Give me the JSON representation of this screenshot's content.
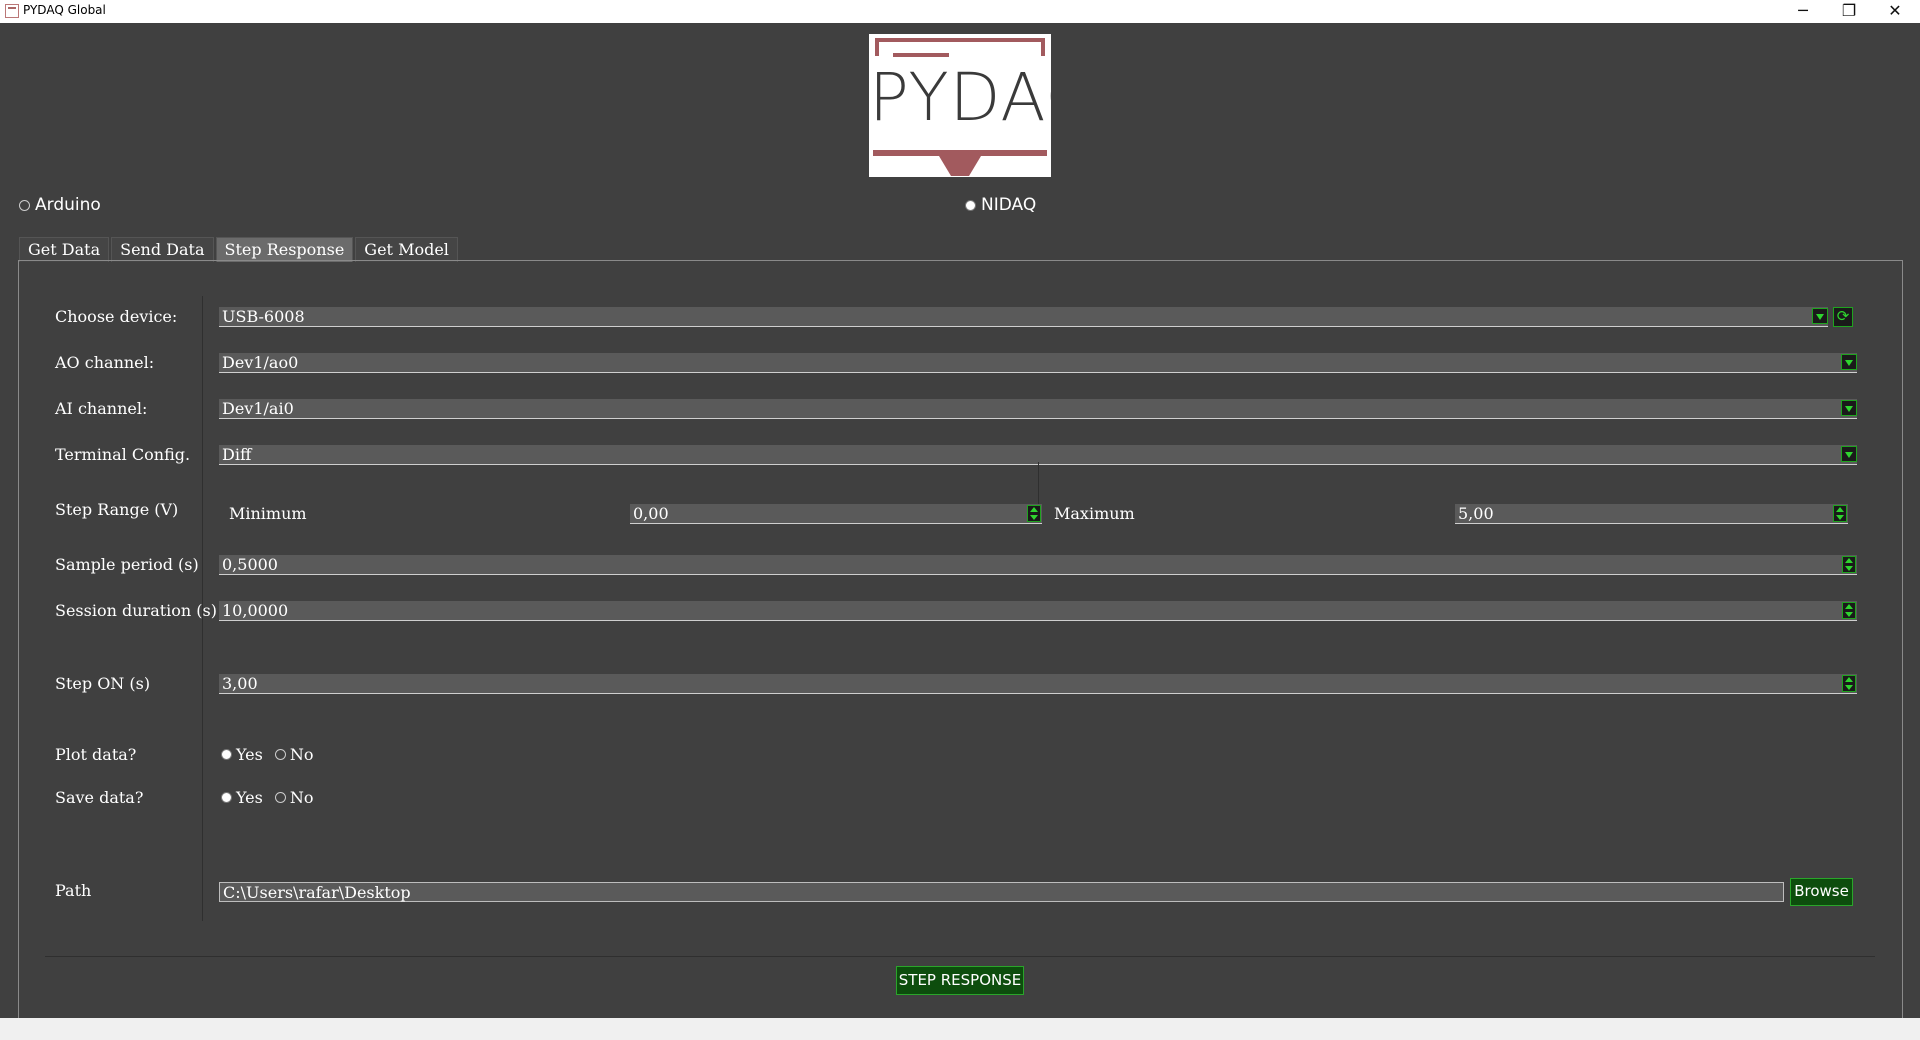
{
  "window": {
    "title": "PYDAQ Global",
    "minimize_glyph": "─",
    "restore_glyph": "❐",
    "close_glyph": "✕"
  },
  "logo": {
    "text": "PYDAQ",
    "colors": {
      "accent": "#a25a5e",
      "text": "#3a3a3a"
    }
  },
  "device_select": {
    "arduino_label": "Arduino",
    "nidaq_label": "NIDAQ",
    "selected": "NIDAQ"
  },
  "tabs": [
    {
      "label": "Get Data",
      "active": false
    },
    {
      "label": "Send Data",
      "active": false
    },
    {
      "label": "Step Response",
      "active": true
    },
    {
      "label": "Get Model",
      "active": false
    }
  ],
  "form": {
    "device": {
      "label": "Choose device:",
      "value": "USB-6008",
      "refresh_icon": "refresh-icon",
      "refresh_glyph": "⟳"
    },
    "ao_channel": {
      "label": "AO channel:",
      "value": "Dev1/ao0"
    },
    "ai_channel": {
      "label": "AI channel:",
      "value": "Dev1/ai0"
    },
    "terminal_config": {
      "label": "Terminal Config.",
      "value": "Diff"
    },
    "step_range": {
      "label": "Step Range (V)",
      "min_label": "Minimum",
      "min_value": "0,00",
      "max_label": "Maximum",
      "max_value": "5,00"
    },
    "sample_period": {
      "label": "Sample period (s)",
      "value": "0,5000"
    },
    "session_duration": {
      "label": "Session duration (s)",
      "value": "10,0000"
    },
    "step_on": {
      "label": "Step ON (s)",
      "value": "3,00"
    },
    "plot_data": {
      "label": "Plot data?",
      "yes": "Yes",
      "no": "No",
      "selected": "Yes"
    },
    "save_data": {
      "label": "Save data?",
      "yes": "Yes",
      "no": "No",
      "selected": "Yes"
    },
    "path": {
      "label": "Path",
      "value": "C:\\Users\\rafar\\Desktop",
      "browse": "Browse"
    }
  },
  "actions": {
    "run_label": "STEP RESPONSE"
  },
  "colors": {
    "background": "#404040",
    "field": "#5a5a5a",
    "button": "#0d4d0d",
    "button_border": "#2aa52a",
    "arrow": "#2fd42f"
  }
}
